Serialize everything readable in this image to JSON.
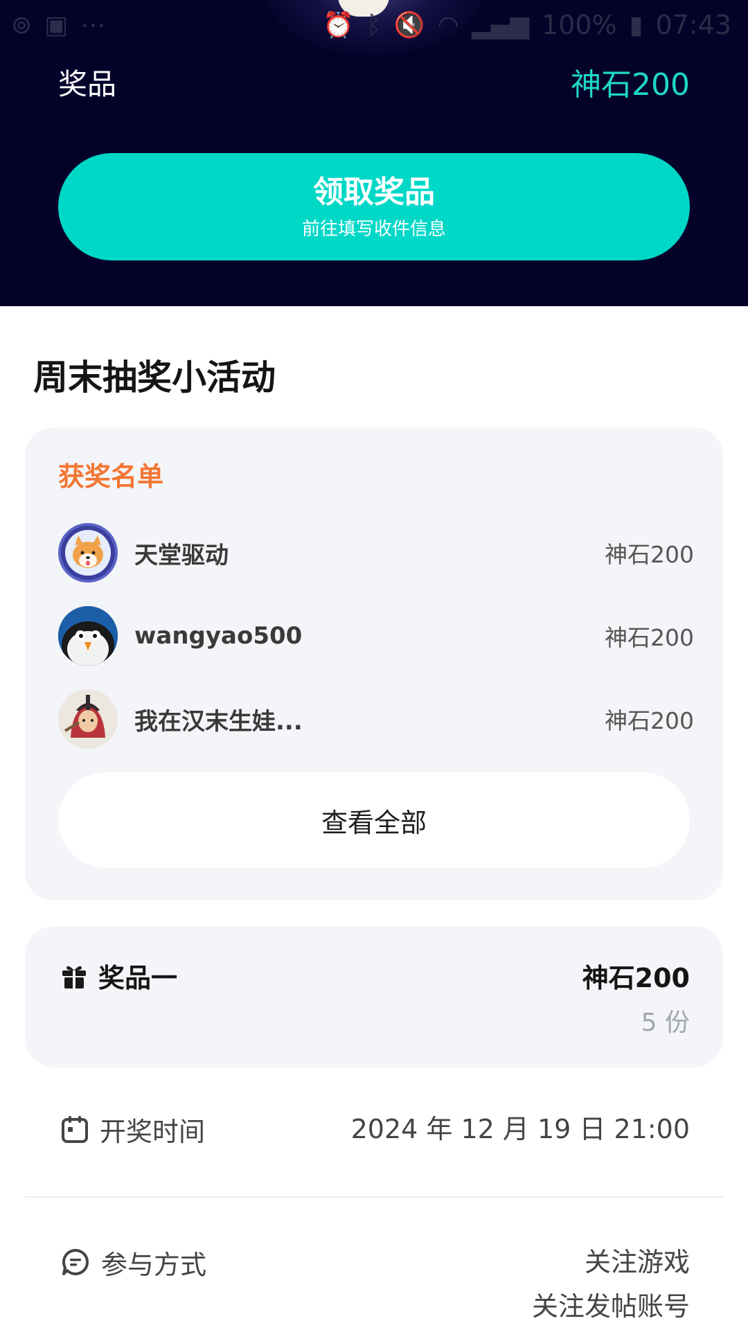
{
  "statusbar": {
    "battery": "100%",
    "time": "07:43"
  },
  "header": {
    "prize_label": "奖品",
    "prize_value": "神石200",
    "claim_button": {
      "title": "领取奖品",
      "subtitle": "前往填写收件信息"
    }
  },
  "activity": {
    "title": "周末抽奖小活动"
  },
  "winners": {
    "heading": "获奖名单",
    "items": [
      {
        "name": "天堂驱动",
        "prize": "神石200"
      },
      {
        "name": "wangyao500",
        "prize": "神石200"
      },
      {
        "name": "我在汉末生娃...",
        "prize": "神石200"
      }
    ],
    "view_all": "查看全部"
  },
  "prize_card": {
    "label": "奖品一",
    "value": "神石200",
    "quantity": "5 份"
  },
  "draw_time": {
    "label": "开奖时间",
    "value": "2024 年 12 月 19 日 21:00"
  },
  "participation": {
    "label": "参与方式",
    "methods": [
      "关注游戏",
      "关注发帖账号"
    ]
  },
  "colors": {
    "header_bg": "#05022a",
    "accent": "#00d8c7",
    "winners_heading": "#f37633",
    "card_bg": "#f4f5f8"
  }
}
